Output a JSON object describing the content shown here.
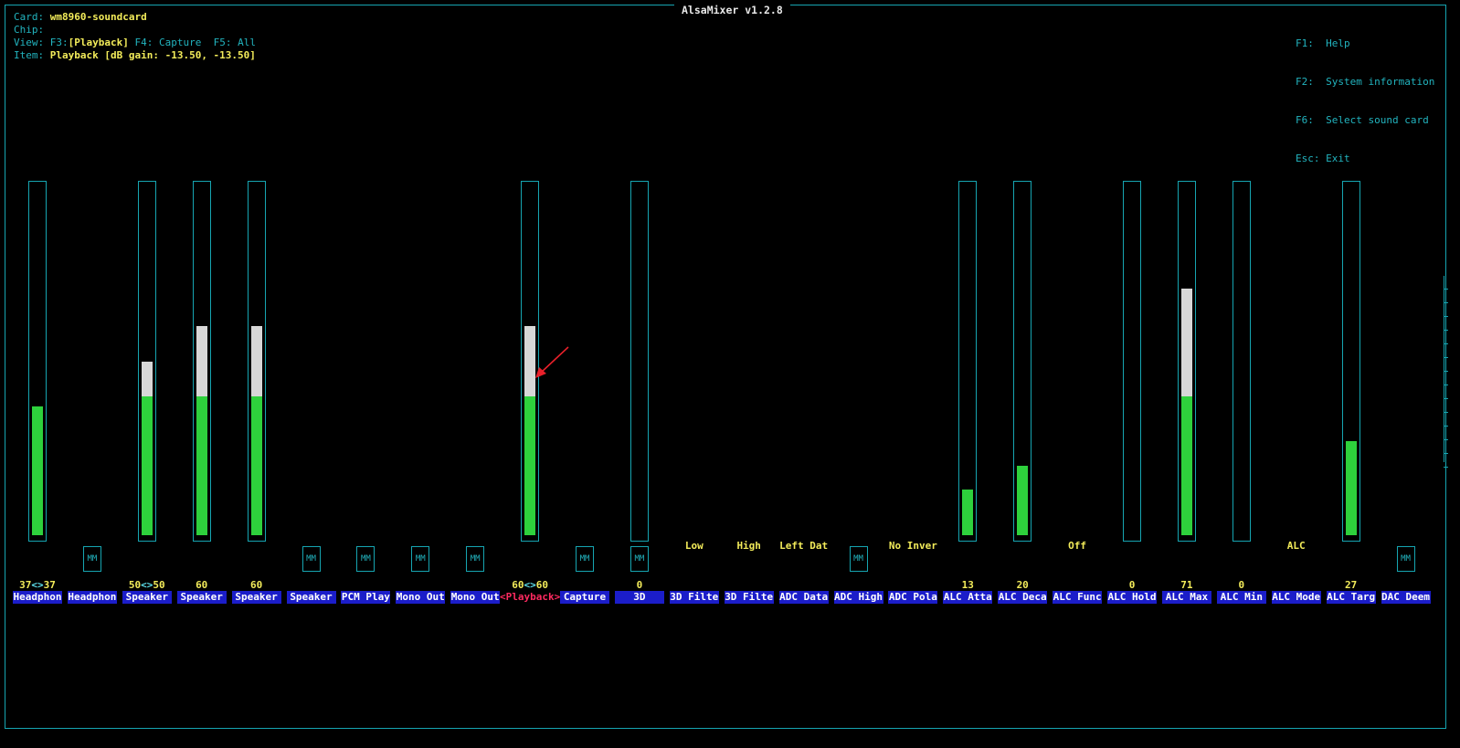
{
  "app_title": "AlsaMixer v1.2.8",
  "header": {
    "card_key": "Card:",
    "card_value": "wm8960-soundcard",
    "chip_key": "Chip:",
    "chip_value": "",
    "view_key": "View:",
    "view_f3_key": "F3:",
    "view_f3": "[Playback]",
    "view_f4": "F4: Capture",
    "view_f5": "F5: All",
    "item_key": "Item:",
    "item_value": "Playback [dB gain: -13.50, -13.50]"
  },
  "help": [
    {
      "key": "F1:",
      "text": "Help"
    },
    {
      "key": "F2:",
      "text": "System information"
    },
    {
      "key": "F6:",
      "text": "Select sound card"
    },
    {
      "key": "Esc:",
      "text": "Exit"
    }
  ],
  "mute_label": "MM",
  "arrow_sep": "<>",
  "controls": [
    {
      "label": "Headphon",
      "value_left": "37",
      "value_right": "37",
      "level": 37
    },
    {
      "label": "Headphon",
      "mute": true
    },
    {
      "label": "Speaker",
      "value_left": "50",
      "value_right": "50",
      "level": 50
    },
    {
      "label": "Speaker",
      "value": "60",
      "level": 60
    },
    {
      "label": "Speaker",
      "value": "60",
      "level": 60
    },
    {
      "label": "Speaker",
      "mute": true
    },
    {
      "label": "PCM Play",
      "mute": true
    },
    {
      "label": "Mono Out",
      "mute": true
    },
    {
      "label": "Mono Out",
      "mute": true
    },
    {
      "label": "<Playback>",
      "value_left": "60",
      "value_right": "60",
      "level": 60,
      "active": true
    },
    {
      "label": "Capture",
      "mute": true
    },
    {
      "label": "3D",
      "value": "0",
      "level": 0
    },
    {
      "label": "3D Filte",
      "enum": "Low"
    },
    {
      "label": "3D Filte",
      "enum": "High"
    },
    {
      "label": "ADC Data",
      "enum": "Left Dat"
    },
    {
      "label": "ADC High",
      "mute": true
    },
    {
      "label": "ADC Pola",
      "enum": "No Inver"
    },
    {
      "label": "ALC Atta",
      "value": "13",
      "level": 13
    },
    {
      "label": "ALC Deca",
      "value": "20",
      "level": 20
    },
    {
      "label": "ALC Func",
      "enum": "Off"
    },
    {
      "label": "ALC Hold",
      "value": "0",
      "level": 0
    },
    {
      "label": "ALC Max",
      "value": "71",
      "level": 71
    },
    {
      "label": "ALC Min",
      "value": "0",
      "level": 0
    },
    {
      "label": "ALC Mode",
      "enum": "ALC"
    },
    {
      "label": "ALC Targ",
      "value": "27",
      "level": 27
    },
    {
      "label": "DAC Deem",
      "mute": true
    }
  ],
  "colors": {
    "border": "#16a5b1",
    "value": "#f3ec5a",
    "label_bg": "#1b1dc9",
    "green": "#2ed13c",
    "white": "#d7d7d7",
    "active": "#ff2a60"
  }
}
